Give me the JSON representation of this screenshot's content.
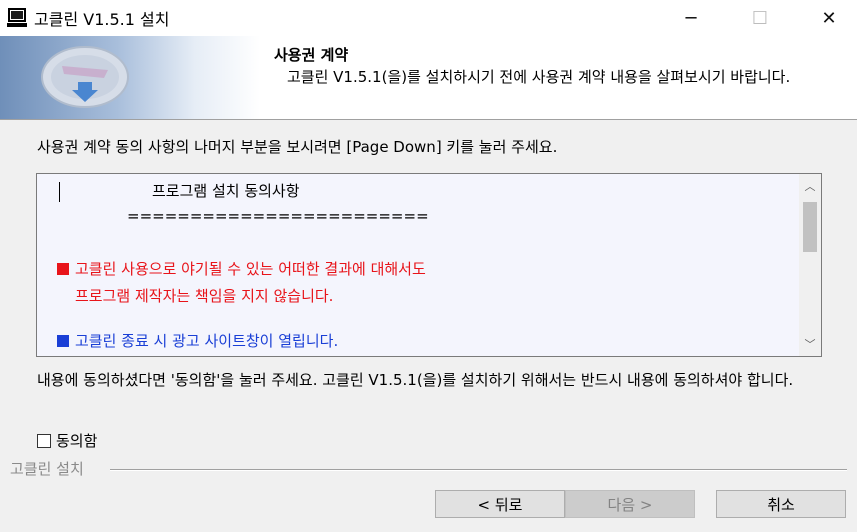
{
  "window": {
    "title": "고클린 V1.5.1 설치",
    "minimize_glyph": "─",
    "maximize_glyph": "☐",
    "close_glyph": "✕",
    "app_icon": "computer-icon"
  },
  "header": {
    "title": "사용권 계약",
    "subtitle": "고클린 V1.5.1(을)를 설치하시기 전에 사용권 계약 내용을 살펴보시기 바랍니다.",
    "art_icon": "installer-disc-icon"
  },
  "instruction": "사용권 계약 동의 사항의 나머지 부분을 보시려면 [Page Down] 키를 눌러 주세요.",
  "license": {
    "title": "프로그램 설치 동의사항",
    "separator": "========================",
    "red_line1": "고클린 사용으로 야기될 수 있는 어떠한 결과에 대해서도",
    "red_line2": "프로그램 제작자는 책임을 지지 않습니다.",
    "blue_line": "고클린 종료 시 광고 사이트창이 열립니다.",
    "scroll_up_glyph": "︿",
    "scroll_down_glyph": "﹀",
    "colors": {
      "red": "#e8141a",
      "blue": "#1a3fd6"
    }
  },
  "accept_text": "내용에 동의하셨다면 '동의함'을 눌러 주세요. 고클린 V1.5.1(을)를 설치하기 위해서는 반드시 내용에 동의하셔야 합니다.",
  "agree_checkbox": {
    "label": "동의함",
    "checked": false
  },
  "group_label": "고클린 설치",
  "buttons": {
    "back": "< 뒤로",
    "next": "다음 >",
    "cancel": "취소"
  }
}
